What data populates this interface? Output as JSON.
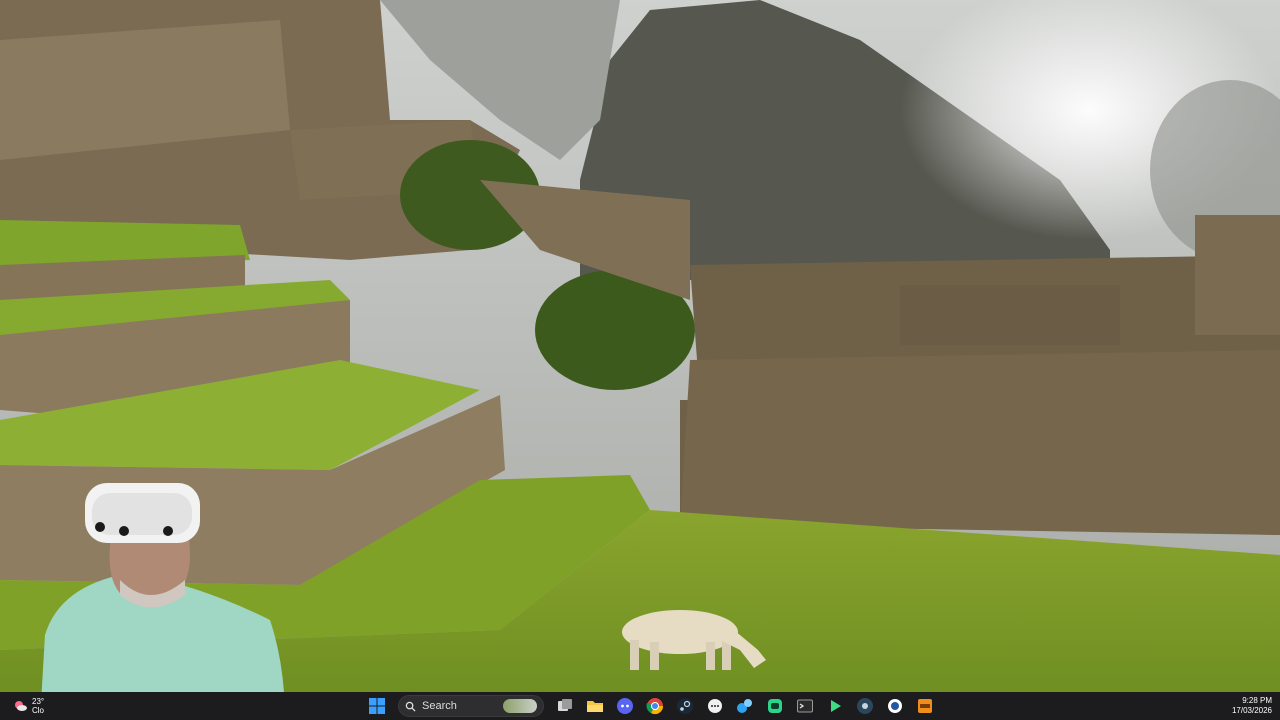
{
  "wallpaper": {
    "sky": "#b9bcb8",
    "grass": "#7d9a2a",
    "stone": "#7b6a4e",
    "mountain": "#4e4f4a"
  },
  "weather": {
    "temp": "23°",
    "condition": "Clo"
  },
  "taskbar": {
    "background": "#1c1c1e",
    "start_label": "Start",
    "search": {
      "label": "Search"
    },
    "apps": [
      {
        "name": "task-view-icon"
      },
      {
        "name": "file-explorer-icon"
      },
      {
        "name": "discord-icon"
      },
      {
        "name": "chrome-icon"
      },
      {
        "name": "steam-icon"
      },
      {
        "name": "chat-icon"
      },
      {
        "name": "app-cluster-icon"
      },
      {
        "name": "green-app-icon"
      },
      {
        "name": "terminal-icon"
      },
      {
        "name": "play-icon"
      },
      {
        "name": "steam-vr-icon"
      },
      {
        "name": "blue-circle-icon"
      },
      {
        "name": "orange-app-icon"
      }
    ]
  },
  "clock": {
    "time": "9:28 PM",
    "date": "17/03/2026"
  }
}
